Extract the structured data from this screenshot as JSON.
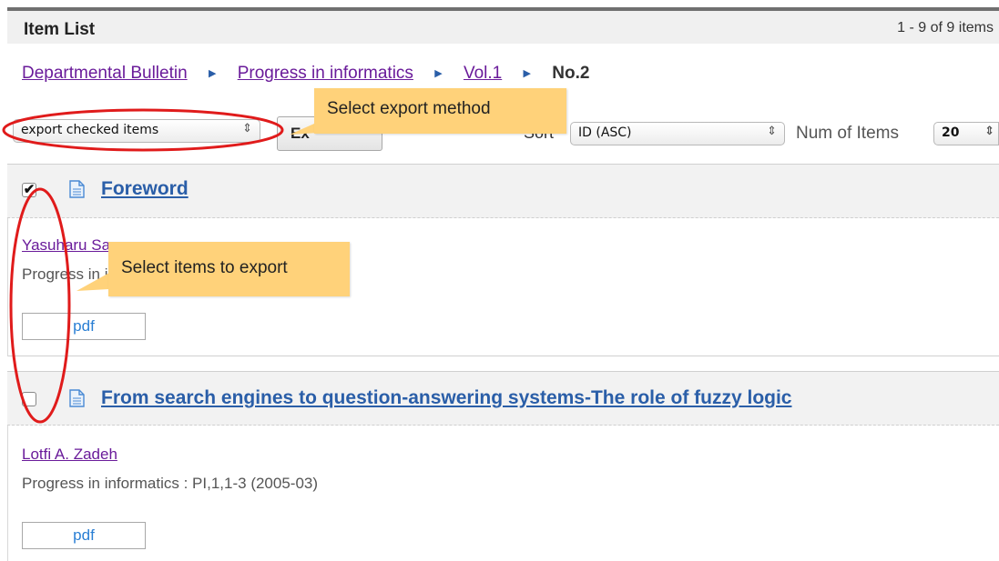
{
  "header": {
    "title": "Item List",
    "count": "1 - 9 of 9 items"
  },
  "breadcrumb": {
    "items": [
      "Departmental Bulletin",
      "Progress in informatics",
      "Vol.1"
    ],
    "current": "No.2",
    "separator": "▶"
  },
  "toolbar": {
    "export_select": "export checked items",
    "export_button": "Ex",
    "sort_label": "Sort",
    "sort_value": "ID (ASC)",
    "num_label": "Num of Items",
    "num_value": "20",
    "select_arrows": "⇕"
  },
  "items": [
    {
      "checked": true,
      "checkmark": "✔",
      "title": "Foreword",
      "author": "Yasuharu Sawamura",
      "citation": "Progress in informatics : PI,1,1-1 (2005-03)",
      "pdf": "pdf"
    },
    {
      "checked": false,
      "checkmark": "",
      "title": "From search engines to question-answering systems-The role of fuzzy logic",
      "author": "Lotfi A. Zadeh",
      "citation": "Progress in informatics : PI,1,1-3 (2005-03)",
      "pdf": "pdf"
    }
  ],
  "annotations": {
    "export_method": "Select export method",
    "export_items": "Select items to export",
    "color_callout": "#ffd27a",
    "color_ellipse": "#e01b1b"
  },
  "colors": {
    "link": "#2a5ea8",
    "visited": "#6a1b9a",
    "pdf": "#2a7fd4"
  }
}
